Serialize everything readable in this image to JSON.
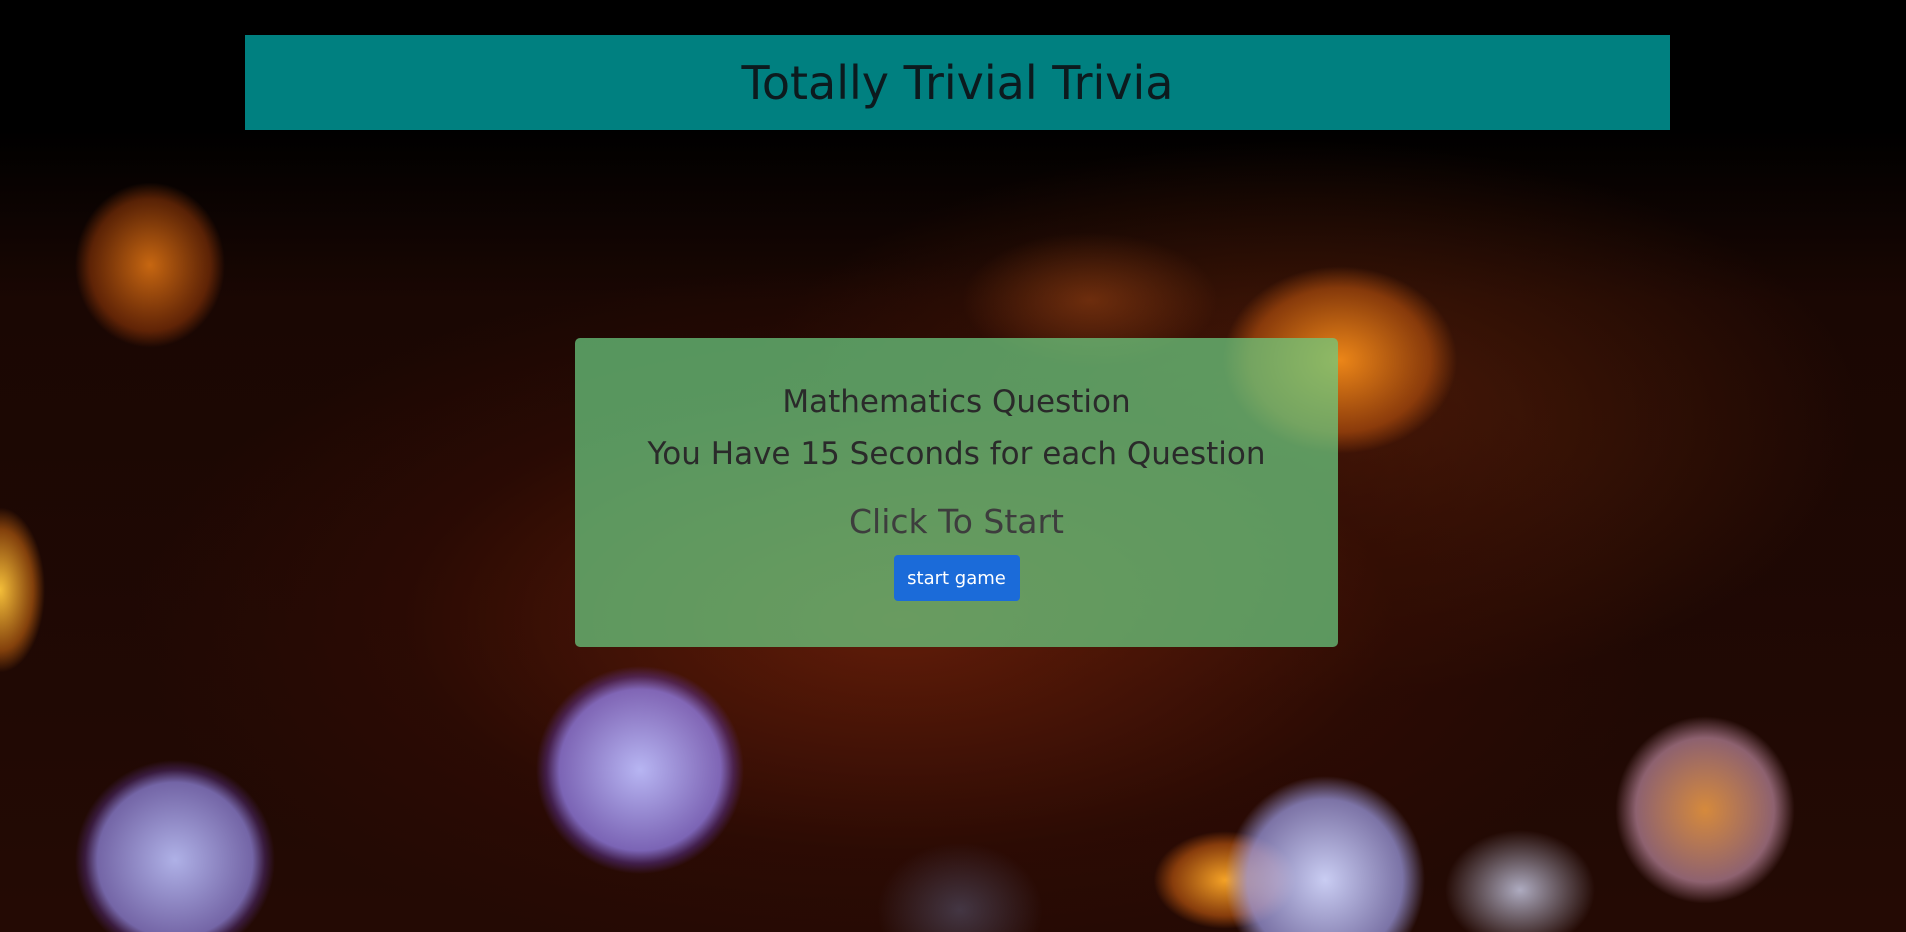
{
  "header": {
    "title": "Totally Trivial Trivia"
  },
  "intro": {
    "category": "Mathematics Question",
    "time_info": "You Have 15 Seconds for each Question",
    "prompt": "Click To Start",
    "start_button_label": "start game"
  },
  "colors": {
    "header_bg": "#008080",
    "panel_bg": "#6ccd82",
    "button_bg": "#1b6bd9"
  }
}
